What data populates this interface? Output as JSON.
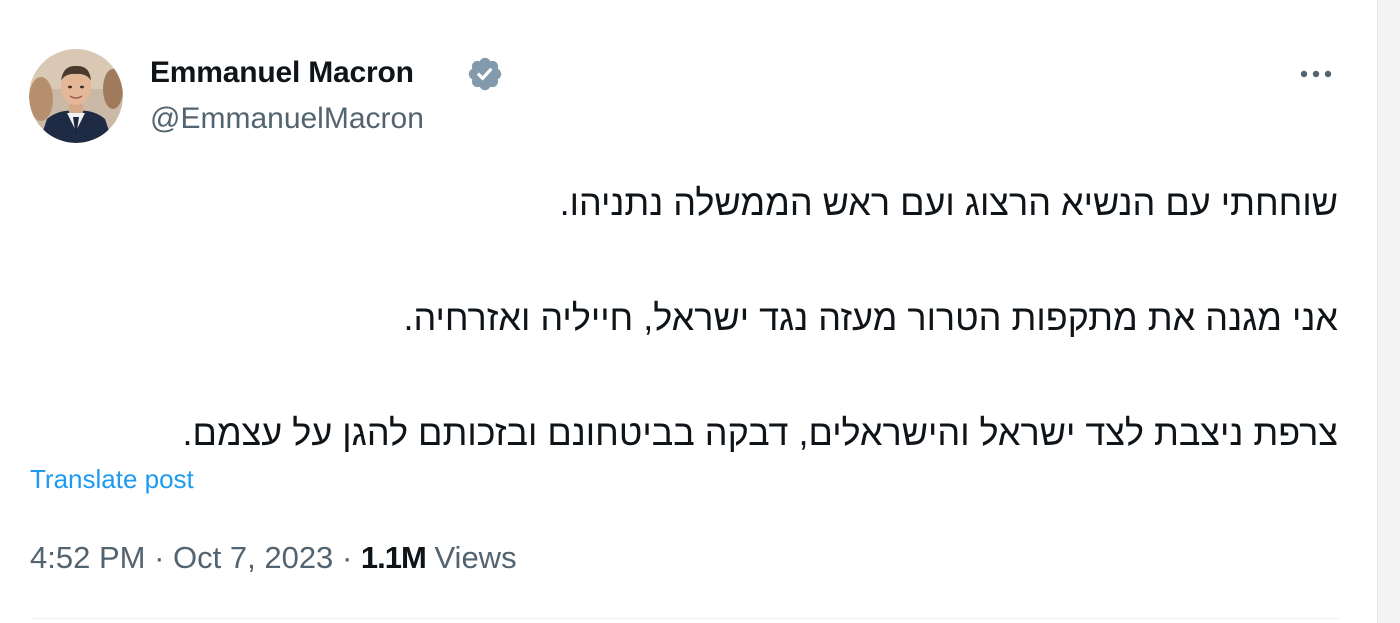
{
  "author": {
    "name": "Emmanuel Macron",
    "handle": "@EmmanuelMacron",
    "verified_badge_color": "#829aab"
  },
  "post": {
    "lines": [
      "שוחחתי עם הנשיא הרצוג ועם ראש הממשלה נתניהו.",
      "אני מגנה את מתקפות הטרור מעזה נגד ישראל, חייליה ואזרחיה.",
      "צרפת ניצבת לצד ישראל והישראלים, דבקה בביטחונם ובזכותם להגן על עצמם."
    ],
    "translate_label": "Translate post"
  },
  "meta": {
    "time": "4:52 PM",
    "separator": "·",
    "date": "Oct 7, 2023",
    "views_count": "1.1M",
    "views_label": "Views"
  },
  "icons": {
    "verified": "verified-badge-icon",
    "more": "more-horizontal-icon"
  },
  "colors": {
    "text_primary": "#0f1419",
    "text_secondary": "#536471",
    "link": "#1d9bf0"
  }
}
